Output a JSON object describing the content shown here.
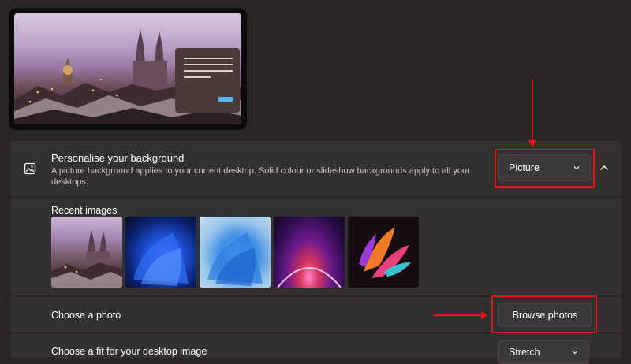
{
  "preview": {
    "image_name": "city-night-wallpaper"
  },
  "background_section": {
    "icon": "image-icon",
    "title": "Personalise your background",
    "description": "A picture background applies to your current desktop. Solid colour or slideshow backgrounds apply to all your desktops.",
    "type_dropdown": {
      "selected": "Picture"
    },
    "collapse_icon": "chevron-up-icon"
  },
  "recent_images": {
    "label": "Recent images",
    "items": [
      "city-night",
      "blue-bloom-dark",
      "blue-bloom-light",
      "purple-glow",
      "colorful-ribbon"
    ]
  },
  "choose_photo": {
    "label": "Choose a photo",
    "button_label": "Browse photos"
  },
  "fit": {
    "label": "Choose a fit for your desktop image",
    "selected": "Stretch"
  },
  "annotation": {
    "highlight_color": "#e0161b"
  },
  "colors": {
    "page_bg": "#282524",
    "card_bg": "#333030",
    "accent": "#59b4ea"
  }
}
